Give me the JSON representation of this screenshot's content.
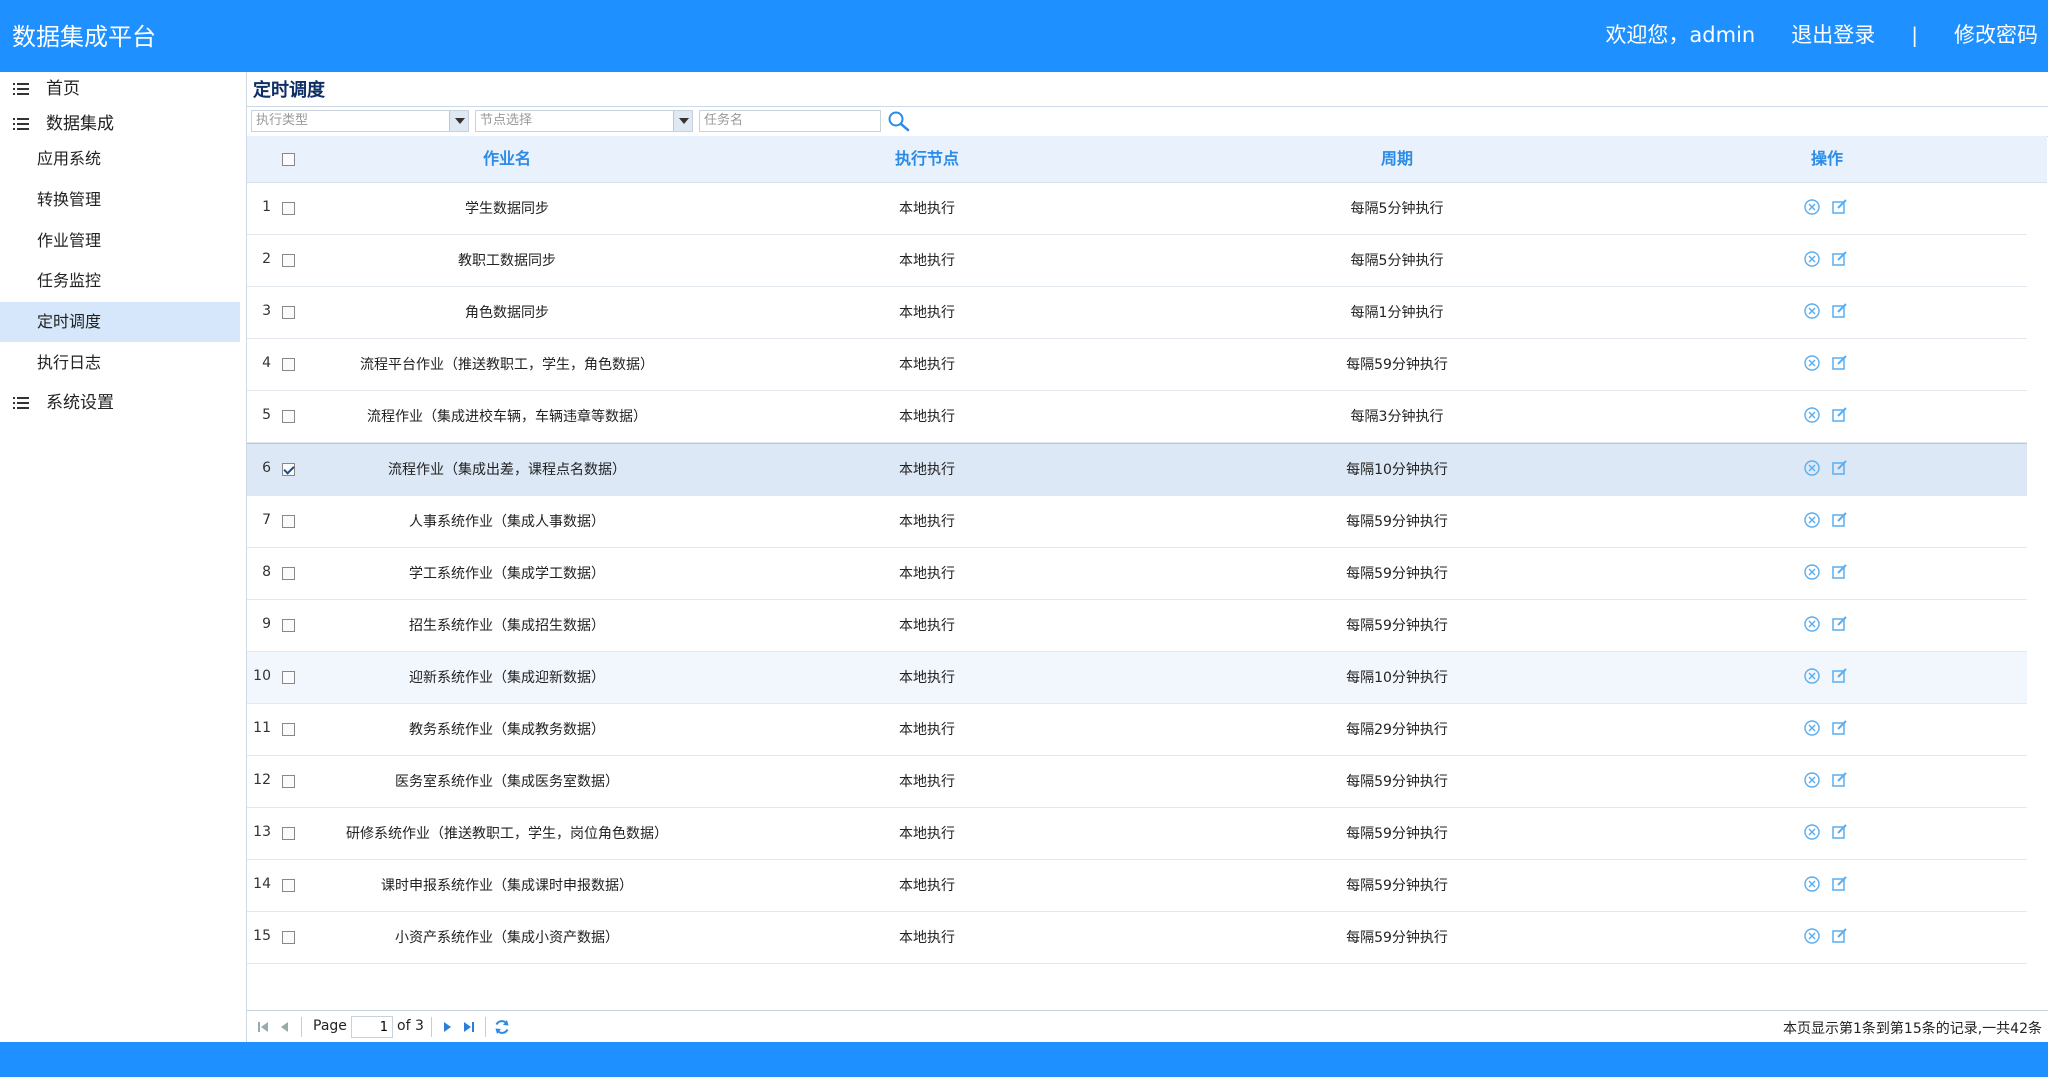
{
  "header": {
    "title": "数据集成平台",
    "welcome": "欢迎您，admin",
    "logout": "退出登录",
    "separator": "|",
    "change_password": "修改密码"
  },
  "sidebar": {
    "home": "首页",
    "data_integration": "数据集成",
    "items": [
      "应用系统",
      "转换管理",
      "作业管理",
      "任务监控",
      "定时调度",
      "执行日志"
    ],
    "active_item": "定时调度",
    "system_settings": "系统设置"
  },
  "page": {
    "title": "定时调度"
  },
  "filters": {
    "exec_type_placeholder": "执行类型",
    "node_placeholder": "节点选择",
    "task_name_placeholder": "任务名"
  },
  "table": {
    "columns": [
      "作业名",
      "执行节点",
      "周期",
      "操作"
    ],
    "rows": [
      {
        "index": "1",
        "name": "学生数据同步",
        "node": "本地执行",
        "period": "每隔5分钟执行",
        "checked": false
      },
      {
        "index": "2",
        "name": "教职工数据同步",
        "node": "本地执行",
        "period": "每隔5分钟执行",
        "checked": false
      },
      {
        "index": "3",
        "name": "角色数据同步",
        "node": "本地执行",
        "period": "每隔1分钟执行",
        "checked": false
      },
      {
        "index": "4",
        "name": "流程平台作业（推送教职工，学生，角色数据）",
        "node": "本地执行",
        "period": "每隔59分钟执行",
        "checked": false
      },
      {
        "index": "5",
        "name": "流程作业（集成进校车辆，车辆违章等数据）",
        "node": "本地执行",
        "period": "每隔3分钟执行",
        "checked": false
      },
      {
        "index": "6",
        "name": "流程作业（集成出差，课程点名数据）",
        "node": "本地执行",
        "period": "每隔10分钟执行",
        "checked": true
      },
      {
        "index": "7",
        "name": "人事系统作业（集成人事数据）",
        "node": "本地执行",
        "period": "每隔59分钟执行",
        "checked": false
      },
      {
        "index": "8",
        "name": "学工系统作业（集成学工数据）",
        "node": "本地执行",
        "period": "每隔59分钟执行",
        "checked": false
      },
      {
        "index": "9",
        "name": "招生系统作业（集成招生数据）",
        "node": "本地执行",
        "period": "每隔59分钟执行",
        "checked": false
      },
      {
        "index": "10",
        "name": "迎新系统作业（集成迎新数据）",
        "node": "本地执行",
        "period": "每隔10分钟执行",
        "checked": false
      },
      {
        "index": "11",
        "name": "教务系统作业（集成教务数据）",
        "node": "本地执行",
        "period": "每隔29分钟执行",
        "checked": false
      },
      {
        "index": "12",
        "name": "医务室系统作业（集成医务室数据）",
        "node": "本地执行",
        "period": "每隔59分钟执行",
        "checked": false
      },
      {
        "index": "13",
        "name": "研修系统作业（推送教职工，学生，岗位角色数据）",
        "node": "本地执行",
        "period": "每隔59分钟执行",
        "checked": false
      },
      {
        "index": "14",
        "name": "课时申报系统作业（集成课时申报数据）",
        "node": "本地执行",
        "period": "每隔59分钟执行",
        "checked": false
      },
      {
        "index": "15",
        "name": "小资产系统作业（集成小资产数据）",
        "node": "本地执行",
        "period": "每隔59分钟执行",
        "checked": false
      }
    ],
    "row_actions": [
      "delete-icon",
      "edit-icon"
    ]
  },
  "pager": {
    "page_label": "Page",
    "current_page": "1",
    "of_label": "of 3",
    "summary": "本页显示第1条到第15条的记录,一共42条"
  },
  "colors": {
    "brand": "#1e90ff",
    "header_text": "#2b8be6",
    "selected_row": "#dde8f6"
  }
}
